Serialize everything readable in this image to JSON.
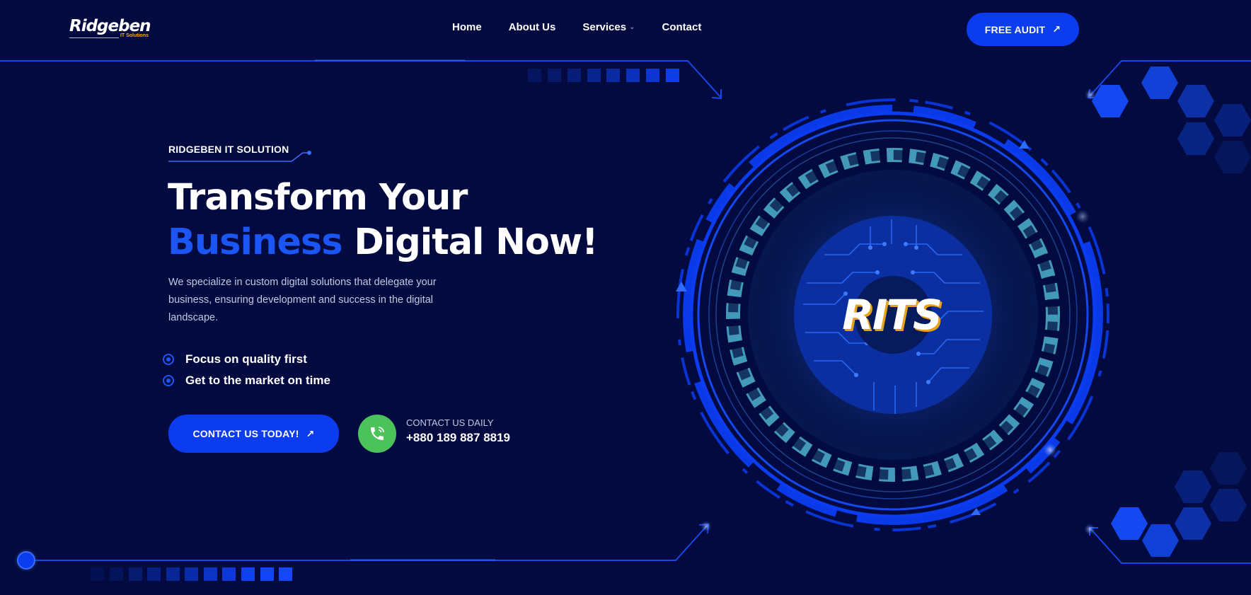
{
  "header": {
    "logo": {
      "name": "Ridgeben",
      "sub": "IT Solutions"
    },
    "nav": [
      {
        "label": "Home"
      },
      {
        "label": "About Us"
      },
      {
        "label": "Services"
      },
      {
        "label": "Contact"
      }
    ],
    "cta_label": "FREE AUDIT"
  },
  "hero": {
    "eyebrow": "RIDGEBEN IT SOLUTION",
    "title_line1": "Transform Your",
    "title_accent": "Business",
    "title_rest": " Digital Now!",
    "description": "We specialize in custom digital solutions that delegate your business, ensuring development and success in the digital landscape.",
    "features": [
      {
        "label": "Focus on quality first"
      },
      {
        "label": "Get to the market on time"
      }
    ],
    "cta_label": "CONTACT US TODAY!",
    "contact_label": "CONTACT US DAILY",
    "contact_phone": "+880 189 887 8819"
  },
  "graphic": {
    "emblem_text": "RITS"
  },
  "colors": {
    "background": "#020a3f",
    "accent_blue": "#0b3cf0",
    "ring_teal": "#4aa8c8",
    "phone_green": "#4cc35a",
    "logo_yellow": "#f5b400"
  }
}
